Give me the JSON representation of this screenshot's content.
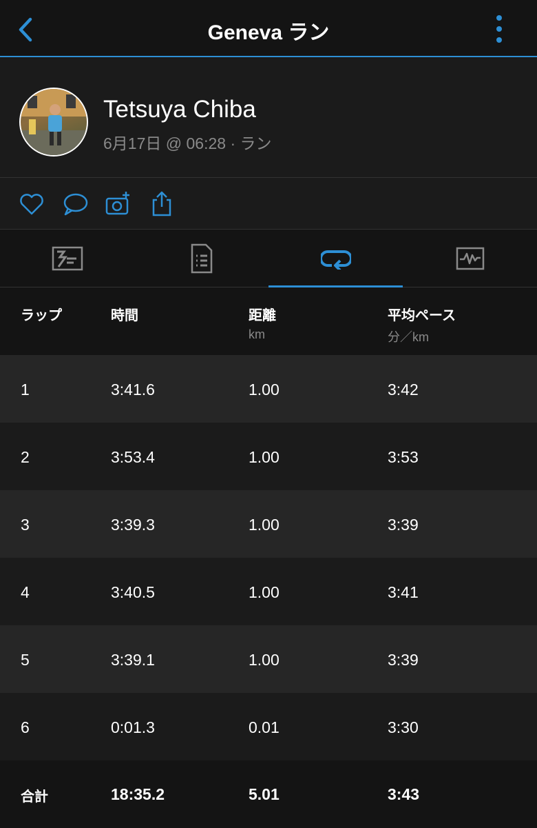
{
  "header": {
    "title": "Geneva ラン"
  },
  "profile": {
    "name": "Tetsuya Chiba",
    "meta": "6月17日 @ 06:28 · ラン"
  },
  "actions": [
    "heart-icon",
    "comment-icon",
    "add-photo-icon",
    "share-icon"
  ],
  "tabs": [
    {
      "icon": "overview-icon",
      "active": false
    },
    {
      "icon": "details-icon",
      "active": false
    },
    {
      "icon": "laps-icon",
      "active": true
    },
    {
      "icon": "charts-icon",
      "active": false
    }
  ],
  "colors": {
    "accent": "#2d8fd5"
  },
  "table": {
    "headers": {
      "lap": "ラップ",
      "time": "時間",
      "distance": "距離",
      "distance_unit": "km",
      "pace": "平均ペース",
      "pace_unit": "分／km"
    },
    "rows": [
      [
        "1",
        "3:41.6",
        "1.00",
        "3:42"
      ],
      [
        "2",
        "3:53.4",
        "1.00",
        "3:53"
      ],
      [
        "3",
        "3:39.3",
        "1.00",
        "3:39"
      ],
      [
        "4",
        "3:40.5",
        "1.00",
        "3:41"
      ],
      [
        "5",
        "3:39.1",
        "1.00",
        "3:39"
      ],
      [
        "6",
        "0:01.3",
        "0.01",
        "3:30"
      ]
    ],
    "total": [
      "合計",
      "18:35.2",
      "5.01",
      "3:43"
    ]
  }
}
